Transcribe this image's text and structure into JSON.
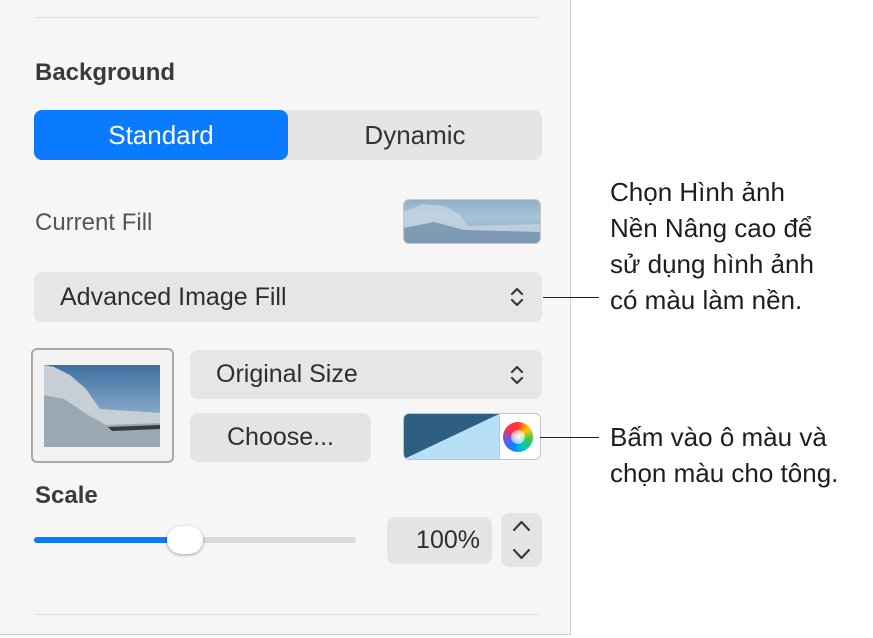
{
  "section": {
    "title": "Background"
  },
  "segmented": {
    "standard": "Standard",
    "dynamic": "Dynamic"
  },
  "current_fill": {
    "label": "Current Fill"
  },
  "fill_type": {
    "selected": "Advanced Image Fill"
  },
  "image_scale": {
    "selected": "Original Size"
  },
  "choose_button": {
    "label": "Choose..."
  },
  "scale": {
    "label": "Scale",
    "value": "100%",
    "slider_fraction": 0.47
  },
  "colors": {
    "accent": "#0a7aff",
    "tint_dark": "#2e5f80",
    "tint_light": "#b7e0f7"
  },
  "annotations": {
    "fill_lines": [
      "Chọn Hình ảnh",
      "Nền Nâng cao để",
      "sử dụng hình ảnh",
      "có màu làm nền."
    ],
    "color_lines": [
      "Bấm vào ô màu và",
      "chọn màu cho tông."
    ]
  }
}
